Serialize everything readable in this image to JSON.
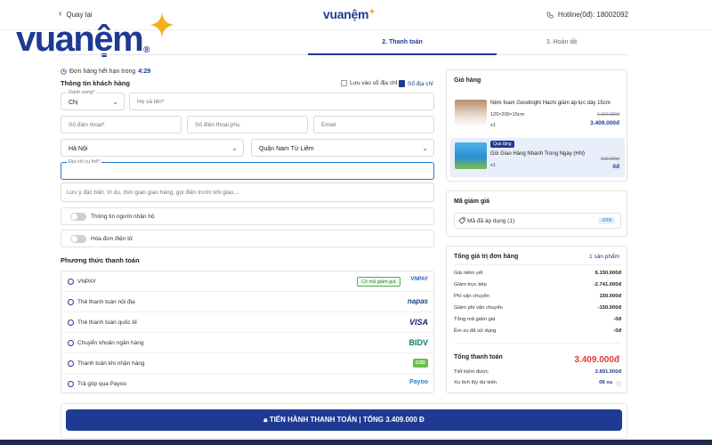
{
  "header": {
    "back_label": "Quay lại",
    "logo_text": "vuanệm",
    "hotline": "Hotline(0đ): 18002092"
  },
  "overlay_logo": {
    "text": "vuanệm",
    "reg": "®"
  },
  "steps": [
    {
      "label": "2. Thanh toán",
      "active": true
    },
    {
      "label": "3. Hoàn tất",
      "active": false
    }
  ],
  "timer": {
    "label": "Đơn hàng hết hạn trong",
    "value": "4:29"
  },
  "customer": {
    "title": "Thông tin khách hàng",
    "save_address": "Lưu vào sổ địa chỉ",
    "address_book": "Sổ địa chỉ",
    "title_field": {
      "label": "Danh xưng",
      "value": "Chị"
    },
    "name_placeholder": "Họ và tên",
    "phone_placeholder": "Số điện thoại",
    "phone2_placeholder": "Số điện thoại phụ",
    "email_placeholder": "Email",
    "province": "Hà Nội",
    "district": "Quận Nam Từ Liêm",
    "address_label": "Địa chỉ cụ thể",
    "note_placeholder": "Lưu ý đặc biệt. Ví dụ, thời gian giao hàng, gọi điện trước khi giao,...",
    "toggle_receiver": "Thông tin người nhận hộ",
    "toggle_einvoice": "Hóa đơn điện tử"
  },
  "payment": {
    "title": "Phương thức thanh toán",
    "promo_tag": "Có mã giảm giá",
    "methods": [
      {
        "label": "VNPAY",
        "logo": "VNPAY"
      },
      {
        "label": "Thẻ thanh toán nội địa",
        "logo": "napas"
      },
      {
        "label": "Thẻ thanh toán quốc tế",
        "logo": "VISA"
      },
      {
        "label": "Chuyển khoản ngân hàng",
        "logo": "BIDV"
      },
      {
        "label": "Thanh toán khi nhận hàng",
        "logo": "COD"
      },
      {
        "label": "Trả góp qua Payoo",
        "logo": "Payoo"
      }
    ]
  },
  "submit_label": "TIẾN HÀNH THANH TOÁN | TỔNG 3.409.000 Đ",
  "cart": {
    "title": "Giỏ hàng",
    "items": [
      {
        "name": "Nệm foam Goodnight Hachi giảm áp lực dày 15cm",
        "spec": "120×200×15cm",
        "qty": "x1",
        "old_price": "6.150.000đ",
        "price": "3.409.000đ"
      },
      {
        "tag": "Quà tặng",
        "name": "Gói Giao Hàng Nhanh Trong Ngày (HN)",
        "qty": "x1",
        "old_price": "500.000đ",
        "price": "0đ"
      }
    ]
  },
  "voucher": {
    "title": "Mã giảm giá",
    "applied": "Mã đã áp dụng (1)",
    "amount": "-200K"
  },
  "summary": {
    "title": "Tổng giá trị đơn hàng",
    "count": "1 sản phẩm",
    "rows": [
      {
        "label": "Giá niêm yết",
        "value": "6.150.000đ"
      },
      {
        "label": "Giảm trực tiếp",
        "value": "-2.741.000đ"
      },
      {
        "label": "Phí vận chuyển",
        "value": "150.000đ"
      },
      {
        "label": "Giảm phí vận chuyển",
        "value": "-150.000đ"
      },
      {
        "label": "Tổng mã giảm giá",
        "value": "-0đ"
      },
      {
        "label": "Êm xu đã sử dụng",
        "value": "-0đ"
      }
    ],
    "total_label": "Tổng thanh toán",
    "total_value": "3.409.000đ",
    "saved_label": "Tiết kiệm được",
    "saved_value": "2.891.000đ",
    "xu_label": "Xu tích lũy dự kiến",
    "xu_value": "08 xu"
  },
  "colors": {
    "brand": "#1f3a93",
    "accent_star": "#f2b01e",
    "price_red": "#e53935"
  }
}
